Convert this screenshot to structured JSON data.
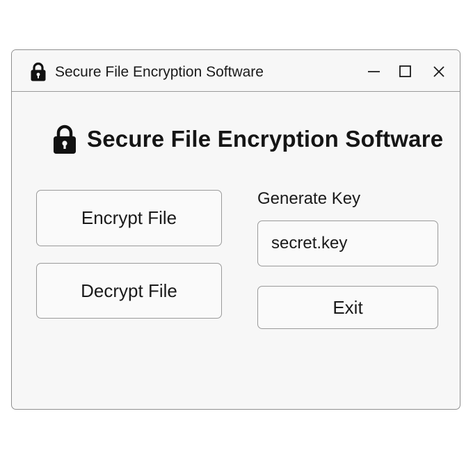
{
  "window": {
    "title": "Secure File Encryption Software",
    "title_icon": "lock-icon",
    "controls": {
      "minimize_icon": "minimize-icon",
      "maximize_icon": "maximize-icon",
      "close_icon": "close-icon"
    }
  },
  "header": {
    "icon": "lock-icon",
    "title": "Secure File Encryption Software"
  },
  "actions": {
    "encrypt_label": "Encrypt File",
    "decrypt_label": "Decrypt File",
    "exit_label": "Exit"
  },
  "key": {
    "label": "Generate Key",
    "value": "secret.key"
  },
  "colors": {
    "window_background": "#f7f7f7",
    "border": "#9a9a9a",
    "text": "#1a1a1a"
  }
}
